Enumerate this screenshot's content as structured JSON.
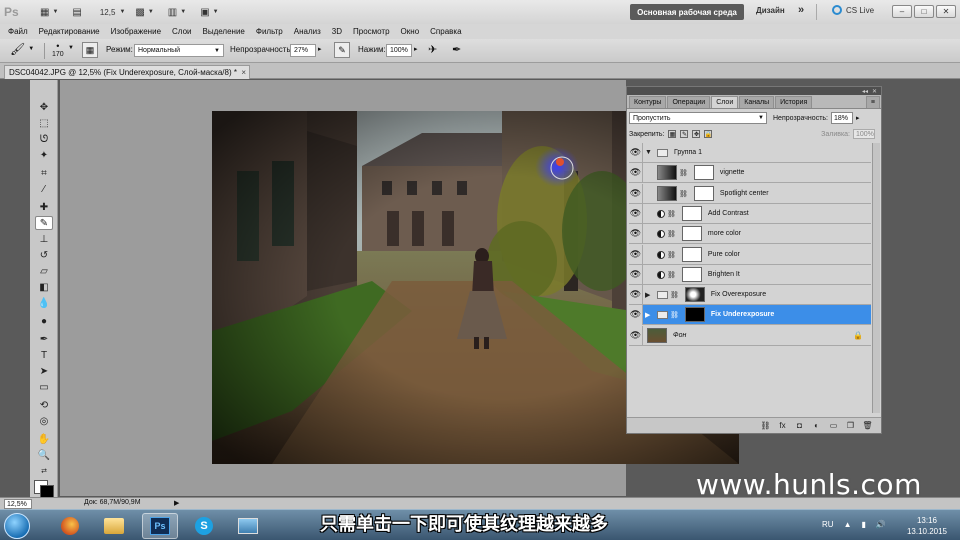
{
  "app": {
    "logo": "Ps",
    "zoom": "12,5",
    "workspace_active": "Основная рабочая среда",
    "workspace_other": "Дизайн",
    "more": "»",
    "cs_live": "CS Live",
    "min": "–",
    "max": "□",
    "close": "✕"
  },
  "menu": [
    "Файл",
    "Редактирование",
    "Изображение",
    "Слои",
    "Выделение",
    "Фильтр",
    "Анализ",
    "3D",
    "Просмотр",
    "Окно",
    "Справка"
  ],
  "options": {
    "brush_size": "170",
    "mode_label": "Режим:",
    "mode_value": "Нормальный",
    "opacity_label": "Непрозрачность:",
    "opacity_value": "27%",
    "flow_label": "Нажим:",
    "flow_value": "100%"
  },
  "document": {
    "tab_title": "DSC04042.JPG @ 12,5% (Fix Underexposure, Слой-маска/8) *",
    "tab_close": "×",
    "zoom_status": "12,5%",
    "doc_info": "Док: 68,7M/90,9M",
    "status_arrow": "▶"
  },
  "layers_panel": {
    "tabs": [
      "Контуры",
      "Операции",
      "Слои",
      "Каналы",
      "История"
    ],
    "active_tab": "Слои",
    "menu_icon": "≡",
    "collapse": "◂◂",
    "close": "✕",
    "blend_mode": "Пропустить",
    "opacity_label": "Непрозрачность:",
    "opacity_value": "18%",
    "lock_label": "Закрепить:",
    "fill_label": "Заливка:",
    "fill_value": "100%",
    "layers": [
      {
        "name": "Группа 1",
        "kind": "group-open"
      },
      {
        "name": "vignette",
        "kind": "gradient"
      },
      {
        "name": "Spotlight center",
        "kind": "gradient"
      },
      {
        "name": "Add Contrast",
        "kind": "adjustment"
      },
      {
        "name": "more color",
        "kind": "adjustment"
      },
      {
        "name": "Pure color",
        "kind": "adjustment"
      },
      {
        "name": "Brighten It",
        "kind": "adjustment"
      },
      {
        "name": "Fix Overexposure",
        "kind": "group"
      },
      {
        "name": "Fix Underexposure",
        "kind": "group",
        "selected": true
      },
      {
        "name": "Фон",
        "kind": "background"
      }
    ]
  },
  "overlay": {
    "watermark": "www.hunls.com",
    "subtitle": "只需单击一下即可使其纹理越来越多"
  },
  "taskbar": {
    "lang": "RU",
    "time": "13:16",
    "date": "13.10.2015",
    "ps_label": "Ps"
  },
  "colors": {
    "selection": "#3c8ee8",
    "workspace_btn": "#5b5b5b",
    "brush_dab": "#3a3cff"
  }
}
